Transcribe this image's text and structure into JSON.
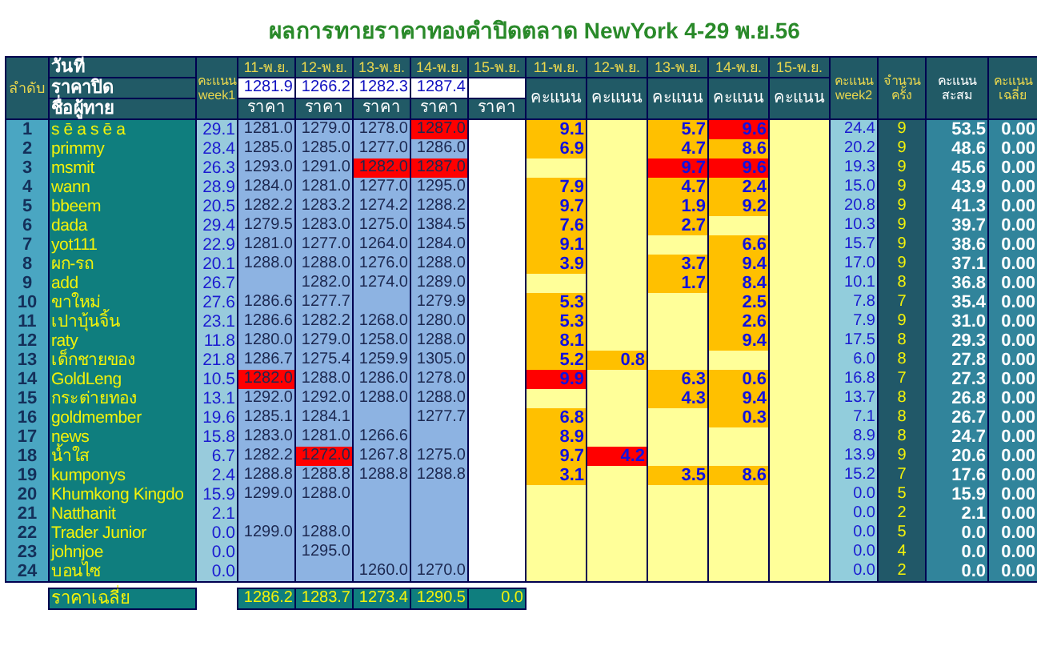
{
  "title": "ผลการทายราคาทองคำปิดตลาด NewYork 4-29 พ.ย.56",
  "header": {
    "rank": "ลำดับ",
    "date": "วันที่",
    "close": "ราคาปิด",
    "name": "ชื่อผู้ทาย",
    "week1": "คะแนน week1",
    "week2": "คะแนน week2",
    "count": "จำนวนครั้ง",
    "total": "คะแนนสะสม",
    "average": "คะแนนเฉลี่ย"
  },
  "price_columns": [
    {
      "date": "11-พ.ย.",
      "close": "1281.9",
      "heading": "ราคา"
    },
    {
      "date": "12-พ.ย.",
      "close": "1266.2",
      "heading": "ราคา"
    },
    {
      "date": "13-พ.ย.",
      "close": "1282.3",
      "heading": "ราคา"
    },
    {
      "date": "14-พ.ย.",
      "close": "1287.4",
      "heading": "ราคา"
    },
    {
      "date": "15-พ.ย.",
      "heading": "ราคา"
    }
  ],
  "score_columns": [
    {
      "date": "11-พ.ย.",
      "heading": "คะแนน"
    },
    {
      "date": "12-พ.ย.",
      "heading": "คะแนน"
    },
    {
      "date": "13-พ.ย.",
      "heading": "คะแนน"
    },
    {
      "date": "14-พ.ย.",
      "heading": "คะแนน"
    },
    {
      "date": "15-พ.ย.",
      "heading": "คะแนน"
    }
  ],
  "rows": [
    {
      "rank": "1",
      "name": "s ē a s ē a",
      "week1": "29.1",
      "prices": [
        {
          "value": "1281.0",
          "highlighted": false
        },
        {
          "value": "1279.0",
          "highlighted": false
        },
        {
          "value": "1278.0",
          "highlighted": false
        },
        {
          "value": "1287.0",
          "highlighted": true
        },
        {
          "highlighted": false
        }
      ],
      "scores": [
        {
          "value": "9.1",
          "kind": "scored"
        },
        {
          "kind": "none"
        },
        {
          "value": "5.7",
          "kind": "scored"
        },
        {
          "value": "9.6",
          "kind": "top"
        },
        {
          "kind": "none"
        }
      ],
      "week2": "24.4",
      "count": "9",
      "total": "53.5",
      "average": "0.00"
    },
    {
      "rank": "2",
      "name": "primmy",
      "week1": "28.4",
      "prices": [
        {
          "value": "1285.0",
          "highlighted": false
        },
        {
          "value": "1285.0",
          "highlighted": false
        },
        {
          "value": "1277.0",
          "highlighted": false
        },
        {
          "value": "1286.0",
          "highlighted": false
        },
        {
          "highlighted": false
        }
      ],
      "scores": [
        {
          "value": "6.9",
          "kind": "scored"
        },
        {
          "kind": "none"
        },
        {
          "value": "4.7",
          "kind": "scored"
        },
        {
          "value": "8.6",
          "kind": "scored"
        },
        {
          "kind": "none"
        }
      ],
      "week2": "20.2",
      "count": "9",
      "total": "48.6",
      "average": "0.00"
    },
    {
      "rank": "3",
      "name": "msmit",
      "week1": "26.3",
      "prices": [
        {
          "value": "1293.0",
          "highlighted": false
        },
        {
          "value": "1291.0",
          "highlighted": false
        },
        {
          "value": "1282.0",
          "highlighted": true
        },
        {
          "value": "1287.0",
          "highlighted": true
        },
        {
          "highlighted": false
        }
      ],
      "scores": [
        {
          "kind": "none"
        },
        {
          "kind": "none"
        },
        {
          "value": "9.7",
          "kind": "top"
        },
        {
          "value": "9.6",
          "kind": "top"
        },
        {
          "kind": "none"
        }
      ],
      "week2": "19.3",
      "count": "9",
      "total": "45.6",
      "average": "0.00"
    },
    {
      "rank": "4",
      "name": "wann",
      "week1": "28.9",
      "prices": [
        {
          "value": "1284.0",
          "highlighted": false
        },
        {
          "value": "1281.0",
          "highlighted": false
        },
        {
          "value": "1277.0",
          "highlighted": false
        },
        {
          "value": "1295.0",
          "highlighted": false
        },
        {
          "highlighted": false
        }
      ],
      "scores": [
        {
          "value": "7.9",
          "kind": "scored"
        },
        {
          "kind": "none"
        },
        {
          "value": "4.7",
          "kind": "scored"
        },
        {
          "value": "2.4",
          "kind": "scored"
        },
        {
          "kind": "none"
        }
      ],
      "week2": "15.0",
      "count": "9",
      "total": "43.9",
      "average": "0.00"
    },
    {
      "rank": "5",
      "name": "bbeem",
      "week1": "20.5",
      "prices": [
        {
          "value": "1282.2",
          "highlighted": false
        },
        {
          "value": "1283.2",
          "highlighted": false
        },
        {
          "value": "1274.2",
          "highlighted": false
        },
        {
          "value": "1288.2",
          "highlighted": false
        },
        {
          "highlighted": false
        }
      ],
      "scores": [
        {
          "value": "9.7",
          "kind": "scored"
        },
        {
          "kind": "none"
        },
        {
          "value": "1.9",
          "kind": "scored"
        },
        {
          "value": "9.2",
          "kind": "scored"
        },
        {
          "kind": "none"
        }
      ],
      "week2": "20.8",
      "count": "9",
      "total": "41.3",
      "average": "0.00"
    },
    {
      "rank": "6",
      "name": "dada",
      "week1": "29.4",
      "prices": [
        {
          "value": "1279.5",
          "highlighted": false
        },
        {
          "value": "1283.0",
          "highlighted": false
        },
        {
          "value": "1275.0",
          "highlighted": false
        },
        {
          "value": "1384.5",
          "highlighted": false
        },
        {
          "highlighted": false
        }
      ],
      "scores": [
        {
          "value": "7.6",
          "kind": "scored"
        },
        {
          "kind": "none"
        },
        {
          "value": "2.7",
          "kind": "scored"
        },
        {
          "kind": "none"
        },
        {
          "kind": "none"
        }
      ],
      "week2": "10.3",
      "count": "9",
      "total": "39.7",
      "average": "0.00"
    },
    {
      "rank": "7",
      "name": "yot111",
      "week1": "22.9",
      "prices": [
        {
          "value": "1281.0",
          "highlighted": false
        },
        {
          "value": "1277.0",
          "highlighted": false
        },
        {
          "value": "1264.0",
          "highlighted": false
        },
        {
          "value": "1284.0",
          "highlighted": false
        },
        {
          "highlighted": false
        }
      ],
      "scores": [
        {
          "value": "9.1",
          "kind": "scored"
        },
        {
          "kind": "none"
        },
        {
          "kind": "none"
        },
        {
          "value": "6.6",
          "kind": "scored"
        },
        {
          "kind": "none"
        }
      ],
      "week2": "15.7",
      "count": "9",
      "total": "38.6",
      "average": "0.00"
    },
    {
      "rank": "8",
      "name": "ผก-รถ",
      "week1": "20.1",
      "prices": [
        {
          "value": "1288.0",
          "highlighted": false
        },
        {
          "value": "1288.0",
          "highlighted": false
        },
        {
          "value": "1276.0",
          "highlighted": false
        },
        {
          "value": "1288.0",
          "highlighted": false
        },
        {
          "highlighted": false
        }
      ],
      "scores": [
        {
          "value": "3.9",
          "kind": "scored"
        },
        {
          "kind": "none"
        },
        {
          "value": "3.7",
          "kind": "scored"
        },
        {
          "value": "9.4",
          "kind": "scored"
        },
        {
          "kind": "none"
        }
      ],
      "week2": "17.0",
      "count": "9",
      "total": "37.1",
      "average": "0.00"
    },
    {
      "rank": "9",
      "name": "add",
      "week1": "26.7",
      "prices": [
        {
          "highlighted": false
        },
        {
          "value": "1282.0",
          "highlighted": false
        },
        {
          "value": "1274.0",
          "highlighted": false
        },
        {
          "value": "1289.0",
          "highlighted": false
        },
        {
          "highlighted": false
        }
      ],
      "scores": [
        {
          "kind": "none"
        },
        {
          "kind": "none"
        },
        {
          "value": "1.7",
          "kind": "scored"
        },
        {
          "value": "8.4",
          "kind": "scored"
        },
        {
          "kind": "none"
        }
      ],
      "week2": "10.1",
      "count": "8",
      "total": "36.8",
      "average": "0.00"
    },
    {
      "rank": "10",
      "name": "ขาใหม่",
      "week1": "27.6",
      "prices": [
        {
          "value": "1286.6",
          "highlighted": false
        },
        {
          "value": "1277.7",
          "highlighted": false
        },
        {
          "highlighted": false
        },
        {
          "value": "1279.9",
          "highlighted": false
        },
        {
          "highlighted": false
        }
      ],
      "scores": [
        {
          "value": "5.3",
          "kind": "scored"
        },
        {
          "kind": "none"
        },
        {
          "kind": "none"
        },
        {
          "value": "2.5",
          "kind": "scored"
        },
        {
          "kind": "none"
        }
      ],
      "week2": "7.8",
      "count": "7",
      "total": "35.4",
      "average": "0.00"
    },
    {
      "rank": "11",
      "name": "เปาบุ้นจิ้น",
      "week1": "23.1",
      "prices": [
        {
          "value": "1286.6",
          "highlighted": false
        },
        {
          "value": "1282.2",
          "highlighted": false
        },
        {
          "value": "1268.0",
          "highlighted": false
        },
        {
          "value": "1280.0",
          "highlighted": false
        },
        {
          "highlighted": false
        }
      ],
      "scores": [
        {
          "value": "5.3",
          "kind": "scored"
        },
        {
          "kind": "none"
        },
        {
          "kind": "none"
        },
        {
          "value": "2.6",
          "kind": "scored"
        },
        {
          "kind": "none"
        }
      ],
      "week2": "7.9",
      "count": "9",
      "total": "31.0",
      "average": "0.00"
    },
    {
      "rank": "12",
      "name": "raty",
      "week1": "11.8",
      "prices": [
        {
          "value": "1280.0",
          "highlighted": false
        },
        {
          "value": "1279.0",
          "highlighted": false
        },
        {
          "value": "1258.0",
          "highlighted": false
        },
        {
          "value": "1288.0",
          "highlighted": false
        },
        {
          "highlighted": false
        }
      ],
      "scores": [
        {
          "value": "8.1",
          "kind": "scored"
        },
        {
          "kind": "none"
        },
        {
          "kind": "none"
        },
        {
          "value": "9.4",
          "kind": "scored"
        },
        {
          "kind": "none"
        }
      ],
      "week2": "17.5",
      "count": "8",
      "total": "29.3",
      "average": "0.00"
    },
    {
      "rank": "13",
      "name": "เด็กชายของ",
      "week1": "21.8",
      "prices": [
        {
          "value": "1286.7",
          "highlighted": false
        },
        {
          "value": "1275.4",
          "highlighted": false
        },
        {
          "value": "1259.9",
          "highlighted": false
        },
        {
          "value": "1305.0",
          "highlighted": false
        },
        {
          "highlighted": false
        }
      ],
      "scores": [
        {
          "value": "5.2",
          "kind": "scored"
        },
        {
          "value": "0.8",
          "kind": "scored"
        },
        {
          "kind": "none"
        },
        {
          "kind": "none"
        },
        {
          "kind": "none"
        }
      ],
      "week2": "6.0",
      "count": "8",
      "total": "27.8",
      "average": "0.00"
    },
    {
      "rank": "14",
      "name": "GoldLeng",
      "week1": "10.5",
      "prices": [
        {
          "value": "1282.0",
          "highlighted": true
        },
        {
          "value": "1288.0",
          "highlighted": false
        },
        {
          "value": "1286.0",
          "highlighted": false
        },
        {
          "value": "1278.0",
          "highlighted": false
        },
        {
          "highlighted": false
        }
      ],
      "scores": [
        {
          "value": "9.9",
          "kind": "top"
        },
        {
          "kind": "none"
        },
        {
          "value": "6.3",
          "kind": "scored"
        },
        {
          "value": "0.6",
          "kind": "scored"
        },
        {
          "kind": "none"
        }
      ],
      "week2": "16.8",
      "count": "7",
      "total": "27.3",
      "average": "0.00"
    },
    {
      "rank": "15",
      "name": "กระต่ายทอง",
      "week1": "13.1",
      "prices": [
        {
          "value": "1292.0",
          "highlighted": false
        },
        {
          "value": "1292.0",
          "highlighted": false
        },
        {
          "value": "1288.0",
          "highlighted": false
        },
        {
          "value": "1288.0",
          "highlighted": false
        },
        {
          "highlighted": false
        }
      ],
      "scores": [
        {
          "kind": "none"
        },
        {
          "kind": "none"
        },
        {
          "value": "4.3",
          "kind": "scored"
        },
        {
          "value": "9.4",
          "kind": "scored"
        },
        {
          "kind": "none"
        }
      ],
      "week2": "13.7",
      "count": "8",
      "total": "26.8",
      "average": "0.00"
    },
    {
      "rank": "16",
      "name": "goldmember",
      "week1": "19.6",
      "prices": [
        {
          "value": "1285.1",
          "highlighted": false
        },
        {
          "value": "1284.1",
          "highlighted": false
        },
        {
          "highlighted": false
        },
        {
          "value": "1277.7",
          "highlighted": false
        },
        {
          "highlighted": false
        }
      ],
      "scores": [
        {
          "value": "6.8",
          "kind": "scored"
        },
        {
          "kind": "none"
        },
        {
          "kind": "none"
        },
        {
          "value": "0.3",
          "kind": "scored"
        },
        {
          "kind": "none"
        }
      ],
      "week2": "7.1",
      "count": "8",
      "total": "26.7",
      "average": "0.00"
    },
    {
      "rank": "17",
      "name": "news",
      "week1": "15.8",
      "prices": [
        {
          "value": "1283.0",
          "highlighted": false
        },
        {
          "value": "1281.0",
          "highlighted": false
        },
        {
          "value": "1266.6",
          "highlighted": false
        },
        {
          "highlighted": false
        },
        {
          "highlighted": false
        }
      ],
      "scores": [
        {
          "value": "8.9",
          "kind": "scored"
        },
        {
          "kind": "none"
        },
        {
          "kind": "none"
        },
        {
          "kind": "none"
        },
        {
          "kind": "none"
        }
      ],
      "week2": "8.9",
      "count": "8",
      "total": "24.7",
      "average": "0.00"
    },
    {
      "rank": "18",
      "name": "น้ำใส",
      "week1": "6.7",
      "prices": [
        {
          "value": "1282.2",
          "highlighted": false
        },
        {
          "value": "1272.0",
          "highlighted": true
        },
        {
          "value": "1267.8",
          "highlighted": false
        },
        {
          "value": "1275.0",
          "highlighted": false
        },
        {
          "highlighted": false
        }
      ],
      "scores": [
        {
          "value": "9.7",
          "kind": "scored"
        },
        {
          "value": "4.2",
          "kind": "top"
        },
        {
          "kind": "none"
        },
        {
          "kind": "none"
        },
        {
          "kind": "none"
        }
      ],
      "week2": "13.9",
      "count": "9",
      "total": "20.6",
      "average": "0.00"
    },
    {
      "rank": "19",
      "name": "kumponys",
      "week1": "2.4",
      "prices": [
        {
          "value": "1288.8",
          "highlighted": false
        },
        {
          "value": "1288.8",
          "highlighted": false
        },
        {
          "value": "1288.8",
          "highlighted": false
        },
        {
          "value": "1288.8",
          "highlighted": false
        },
        {
          "highlighted": false
        }
      ],
      "scores": [
        {
          "value": "3.1",
          "kind": "scored"
        },
        {
          "kind": "none"
        },
        {
          "value": "3.5",
          "kind": "scored"
        },
        {
          "value": "8.6",
          "kind": "scored"
        },
        {
          "kind": "none"
        }
      ],
      "week2": "15.2",
      "count": "7",
      "total": "17.6",
      "average": "0.00"
    },
    {
      "rank": "20",
      "name": "Khumkong Kingdo",
      "week1": "15.9",
      "prices": [
        {
          "value": "1299.0",
          "highlighted": false
        },
        {
          "value": "1288.0",
          "highlighted": false
        },
        {
          "highlighted": false
        },
        {
          "highlighted": false
        },
        {
          "highlighted": false
        }
      ],
      "scores": [
        {
          "kind": "none"
        },
        {
          "kind": "none"
        },
        {
          "kind": "none"
        },
        {
          "kind": "none"
        },
        {
          "kind": "none"
        }
      ],
      "week2": "0.0",
      "count": "5",
      "total": "15.9",
      "average": "0.00"
    },
    {
      "rank": "21",
      "name": "Natthanit",
      "week1": "2.1",
      "prices": [
        {
          "highlighted": false
        },
        {
          "highlighted": false
        },
        {
          "highlighted": false
        },
        {
          "highlighted": false
        },
        {
          "highlighted": false
        }
      ],
      "scores": [
        {
          "kind": "none"
        },
        {
          "kind": "none"
        },
        {
          "kind": "none"
        },
        {
          "kind": "none"
        },
        {
          "kind": "none"
        }
      ],
      "week2": "0.0",
      "count": "2",
      "total": "2.1",
      "average": "0.00"
    },
    {
      "rank": "22",
      "name": "Trader Junior",
      "week1": "0.0",
      "prices": [
        {
          "value": "1299.0",
          "highlighted": false
        },
        {
          "value": "1288.0",
          "highlighted": false
        },
        {
          "highlighted": false
        },
        {
          "highlighted": false
        },
        {
          "highlighted": false
        }
      ],
      "scores": [
        {
          "kind": "none"
        },
        {
          "kind": "none"
        },
        {
          "kind": "none"
        },
        {
          "kind": "none"
        },
        {
          "kind": "none"
        }
      ],
      "week2": "0.0",
      "count": "5",
      "total": "0.0",
      "average": "0.00"
    },
    {
      "rank": "23",
      "name": "johnjoe",
      "week1": "0.0",
      "prices": [
        {
          "highlighted": false
        },
        {
          "value": "1295.0",
          "highlighted": false
        },
        {
          "highlighted": false
        },
        {
          "highlighted": false
        },
        {
          "highlighted": false
        }
      ],
      "scores": [
        {
          "kind": "none"
        },
        {
          "kind": "none"
        },
        {
          "kind": "none"
        },
        {
          "kind": "none"
        },
        {
          "kind": "none"
        }
      ],
      "week2": "0.0",
      "count": "4",
      "total": "0.0",
      "average": "0.00"
    },
    {
      "rank": "24",
      "name": "บอนไซ",
      "week1": "0.0",
      "prices": [
        {
          "highlighted": false
        },
        {
          "highlighted": false
        },
        {
          "value": "1260.0",
          "highlighted": false
        },
        {
          "value": "1270.0",
          "highlighted": false
        },
        {
          "highlighted": false
        }
      ],
      "scores": [
        {
          "kind": "none"
        },
        {
          "kind": "none"
        },
        {
          "kind": "none"
        },
        {
          "kind": "none"
        },
        {
          "kind": "none"
        }
      ],
      "week2": "0.0",
      "count": "2",
      "total": "0.0",
      "average": "0.00"
    }
  ],
  "averages": {
    "label": "ราคาเฉลี่ย",
    "values": [
      "1286.2",
      "1283.7",
      "1273.4",
      "1290.5",
      "0.0"
    ]
  }
}
